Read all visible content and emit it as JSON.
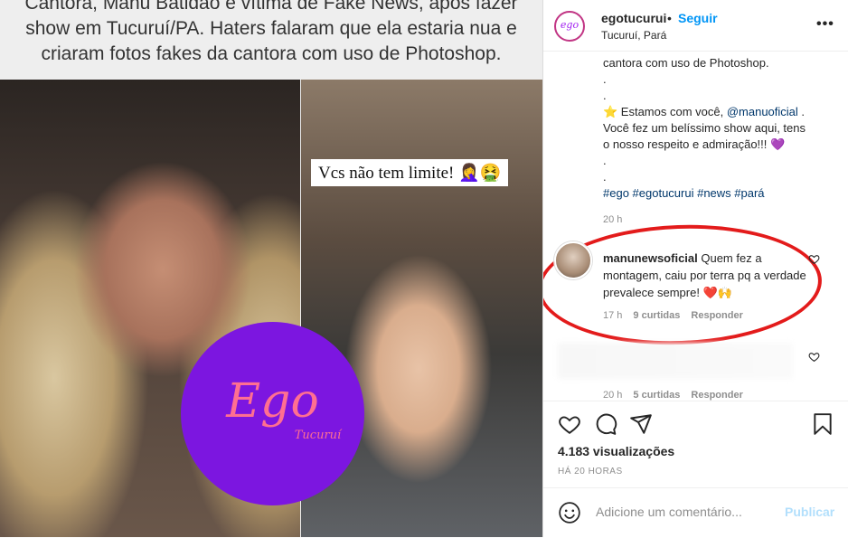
{
  "post_image": {
    "headline_lines": [
      "Cantora, Manu Batidão é vítima de Fake News, após fazer",
      "show em Tucuruí/PA. Haters falaram que ela estaria nua e",
      "criaram fotos fakes da cantora com uso de Photoshop."
    ],
    "story_label": "Vcs não tem limite! 🤦‍♀️🤮",
    "logo_main": "Ego",
    "logo_sub": "Tucuruí"
  },
  "header": {
    "avatar_text": "ego",
    "username": "egotucurui",
    "separator": "•",
    "follow_label": "Seguir",
    "location": "Tucuruí, Pará",
    "more_label": "•••"
  },
  "caption": {
    "line1": "cantora com uso de Photoshop.",
    "dot1": ".",
    "dot2": ".",
    "support_prefix": "⭐ Estamos com você, ",
    "mention": "@manuoficial",
    "support_suffix": " .",
    "line_b": "Você fez um belíssimo show aqui, tens",
    "line_c": "o nosso respeito e admiração!!! 💜",
    "dot3": ".",
    "dot4": ".",
    "hashtags": "#ego #egotucurui #news #pará",
    "time": "20 h"
  },
  "comment": {
    "username": "manunewsoficial",
    "text": " Quem fez a montagem, caiu por terra pq a verdade prevalece sempre! ❤️🙌",
    "time": "17 h",
    "likes": "9 curtidas",
    "reply": "Responder"
  },
  "comment2": {
    "time": "20 h",
    "likes": "5 curtidas",
    "reply": "Responder"
  },
  "actions": {
    "views": "4.183 visualizações",
    "ago": "HÁ 20 HORAS"
  },
  "add_comment": {
    "placeholder": "Adicione um comentário...",
    "publish_label": "Publicar"
  },
  "colors": {
    "accent": "#0095f6",
    "annotation": "#e31b1b",
    "logo_bg": "#7c16e0"
  }
}
